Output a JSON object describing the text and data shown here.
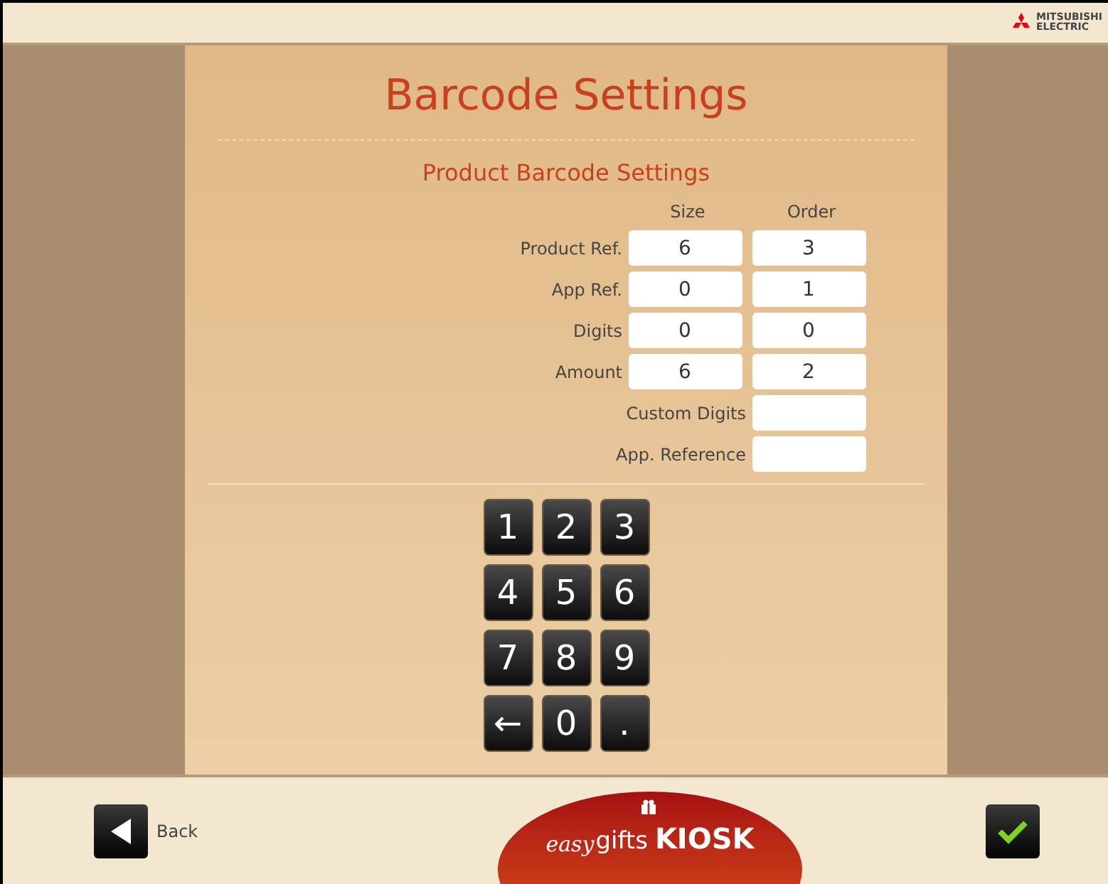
{
  "brand_logo": {
    "line_1": "MITSUBISHI",
    "line_2": "ELECTRIC"
  },
  "title": "Barcode Settings",
  "section_title": "Product Barcode Settings",
  "columns": [
    "Size",
    "Order"
  ],
  "rows": [
    {
      "kind": "pair",
      "label": "Product Ref.",
      "size": "6",
      "order": "3"
    },
    {
      "kind": "pair",
      "label": "App Ref.",
      "size": "0",
      "order": "1"
    },
    {
      "kind": "pair",
      "label": "Digits",
      "size": "0",
      "order": "0"
    },
    {
      "kind": "pair",
      "label": "Amount",
      "size": "6",
      "order": "2"
    },
    {
      "kind": "single",
      "label": "Custom Digits"
    },
    {
      "kind": "single",
      "label": "App. Reference"
    }
  ],
  "keypad": [
    "1",
    "2",
    "3",
    "4",
    "5",
    "6",
    "7",
    "8",
    "9",
    "←",
    "0",
    "."
  ],
  "back_label": "Back",
  "kiosk_logo": {
    "script": "easy",
    "word": "gifts",
    "name": "KIOSK"
  }
}
